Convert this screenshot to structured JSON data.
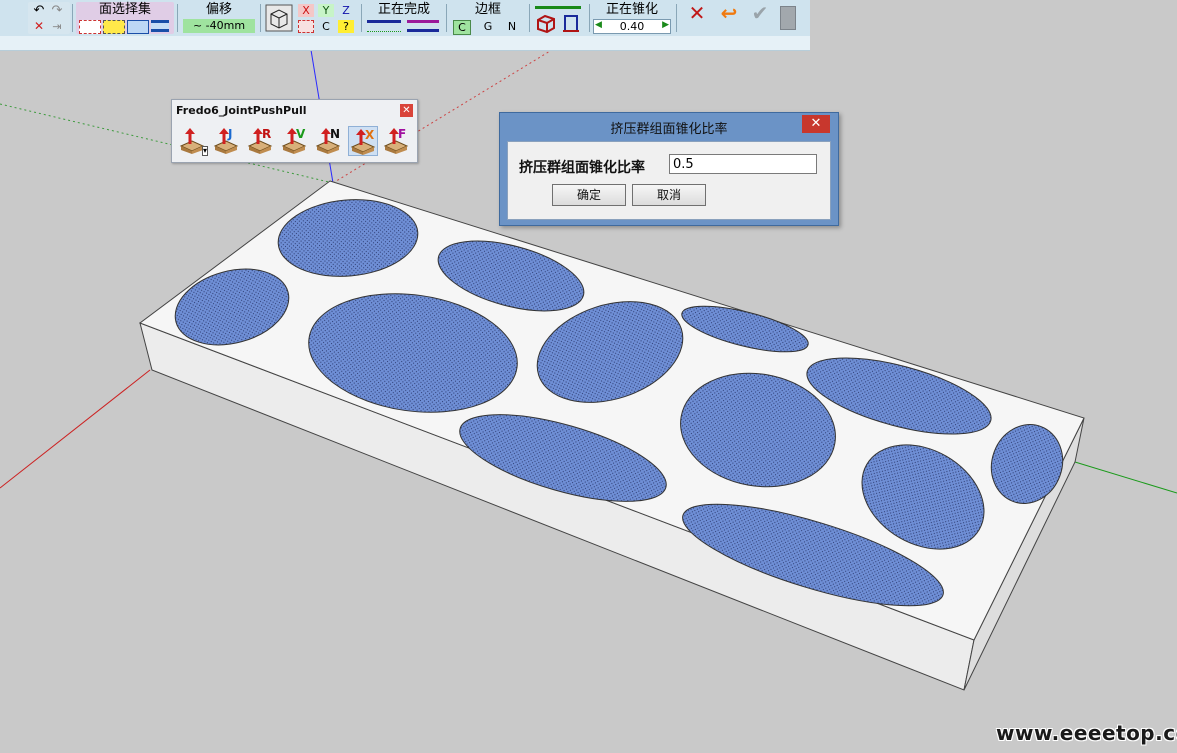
{
  "toolbar": {
    "face_selection_title": "面选择集",
    "offset_title": "偏移",
    "offset_value": "~ -40mm",
    "axis_x": "X",
    "axis_y": "Y",
    "axis_z": "Z",
    "axis_c": "C",
    "axis_q": "?",
    "finishing_title": "正在完成",
    "border_title": "边框",
    "border_c": "C",
    "border_g": "G",
    "border_n": "N",
    "taper_title": "正在锥化",
    "taper_value": "0.40",
    "icons": [
      "undo-icon",
      "redo-icon",
      "cancel-icon",
      "forward-icon",
      "cube-icon",
      "check-icon",
      "exit-icon"
    ]
  },
  "fredo_panel": {
    "title": "Fredo6_JointPushPull",
    "tools": [
      {
        "letter": "",
        "name": "joint-push-pull-dropdown"
      },
      {
        "letter": "J",
        "name": "joint-tool"
      },
      {
        "letter": "R",
        "name": "round-tool"
      },
      {
        "letter": "V",
        "name": "vector-tool"
      },
      {
        "letter": "N",
        "name": "normal-tool"
      },
      {
        "letter": "X",
        "name": "extrude-tool"
      },
      {
        "letter": "F",
        "name": "follow-tool"
      }
    ]
  },
  "dialog": {
    "title": "挤压群组面锥化比率",
    "label": "挤压群组面锥化比率",
    "value": "0.5",
    "ok_label": "确定",
    "cancel_label": "取消"
  },
  "watermark": "www.eeeetop.com",
  "colors": {
    "face_fill": "#6f8fd6",
    "slab_top": "#f4f4f4",
    "background": "#c9c9c9",
    "toolbar_bg": "#cfe3ee",
    "dialog_frame": "#6b93c6"
  }
}
